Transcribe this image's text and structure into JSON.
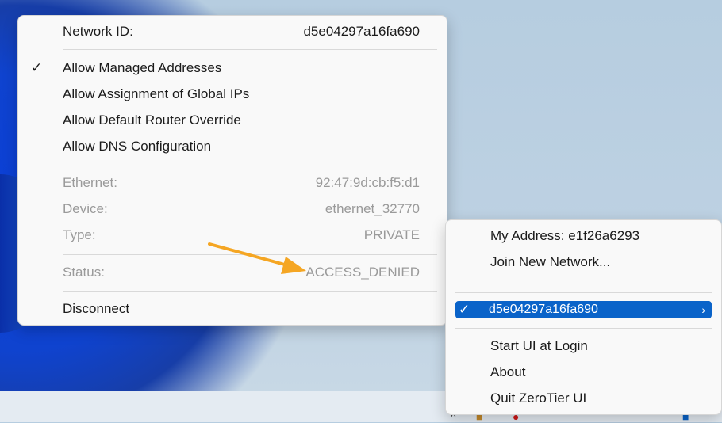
{
  "network_menu": {
    "network_id_label": "Network ID:",
    "network_id_value": "d5e04297a16fa690",
    "options": [
      {
        "label": "Allow Managed Addresses",
        "checked": true
      },
      {
        "label": "Allow Assignment of Global IPs",
        "checked": false
      },
      {
        "label": "Allow Default Router Override",
        "checked": false
      },
      {
        "label": "Allow DNS Configuration",
        "checked": false
      }
    ],
    "info": [
      {
        "label": "Ethernet:",
        "value": "92:47:9d:cb:f5:d1"
      },
      {
        "label": "Device:",
        "value": "ethernet_32770"
      },
      {
        "label": "Type:",
        "value": "PRIVATE"
      }
    ],
    "status_label": "Status:",
    "status_value": "ACCESS_DENIED",
    "disconnect_label": "Disconnect"
  },
  "tray_menu": {
    "my_address": "My Address:  e1f26a6293",
    "join_network": "Join New Network...",
    "network_item": "d5e04297a16fa690",
    "start_ui_at_login": "Start UI at Login",
    "about": "About",
    "quit": "Quit ZeroTier UI"
  },
  "icons": {
    "check": "✓",
    "chevron": "›",
    "annotation_arrow": "orange-arrow"
  },
  "colors": {
    "highlight": "#0a63c9",
    "arrow": "#f5a623"
  }
}
